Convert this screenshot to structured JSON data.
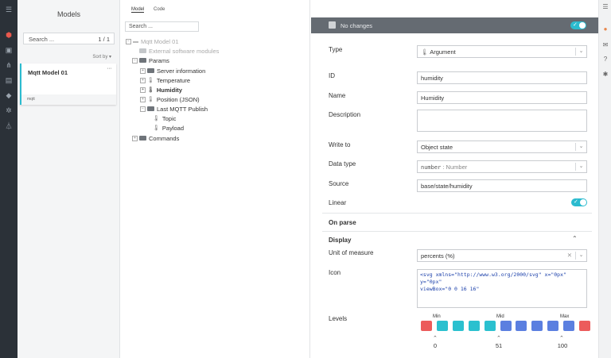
{
  "models_panel": {
    "title": "Models",
    "search_placeholder": "Search ...",
    "count": "1 / 1",
    "sort_label": "Sort by ▾",
    "model": {
      "name": "Mqtt Model 01",
      "more": "···",
      "tag": "mqtt"
    }
  },
  "tabs": [
    {
      "label": "Model",
      "active": true
    },
    {
      "label": "Code",
      "active": false
    }
  ],
  "tree": {
    "search_placeholder": "Search ...",
    "items": [
      {
        "label": "Mqtt Model 01"
      },
      {
        "label": "External software modules"
      },
      {
        "label": "Params"
      },
      {
        "label": "Server information"
      },
      {
        "label": "Temperature"
      },
      {
        "label": "Humidity"
      },
      {
        "label": "Position (JSON)"
      },
      {
        "label": "Last MQTT Publish"
      },
      {
        "label": "Topic"
      },
      {
        "label": "Payload"
      },
      {
        "label": "Commands"
      }
    ]
  },
  "status": {
    "text": "No changes",
    "toggle_on": true
  },
  "form": {
    "type_label": "Type",
    "type_value": "Argument",
    "id_label": "ID",
    "id_value": "humidity",
    "name_label": "Name",
    "name_value": "Humidity",
    "description_label": "Description",
    "description_value": "",
    "write_to_label": "Write to",
    "write_to_value": "Object state",
    "data_type_label": "Data type",
    "data_type_code": "number",
    "data_type_value": ": Number",
    "source_label": "Source",
    "source_value": "base/state/humidity",
    "linear_label": "Linear",
    "linear_on": true,
    "on_parse_label": "On parse",
    "display_label": "Display",
    "unit_label": "Unit of measure",
    "unit_value": "percents (%)",
    "icon_label": "Icon",
    "icon_code_1": "<svg xmlns=\"http://www.w3.org/2000/svg\" x=\"0px\"",
    "icon_code_2": "y=\"0px\"",
    "icon_code_3": "viewBox=\"0 0 16 16\"",
    "levels_label": "Levels",
    "levels_min_label": "Min",
    "levels_mid_label": "Mid",
    "levels_max_label": "Max",
    "levels_min_value": "0",
    "levels_mid_value": "51",
    "levels_max_value": "100",
    "level_colors": [
      "#ec5b5b",
      "#2bc0cf",
      "#2bc0cf",
      "#2bc0cf",
      "#2bc0cf",
      "#5b7fe0",
      "#5b7fe0",
      "#5b7fe0",
      "#5b7fe0",
      "#5b7fe0",
      "#ec5b5b"
    ]
  },
  "colors": {
    "accent": "#2bbbcf",
    "nav_bg": "#2b3138",
    "status_bg": "#656b72",
    "active_nav": "#e8584d"
  }
}
